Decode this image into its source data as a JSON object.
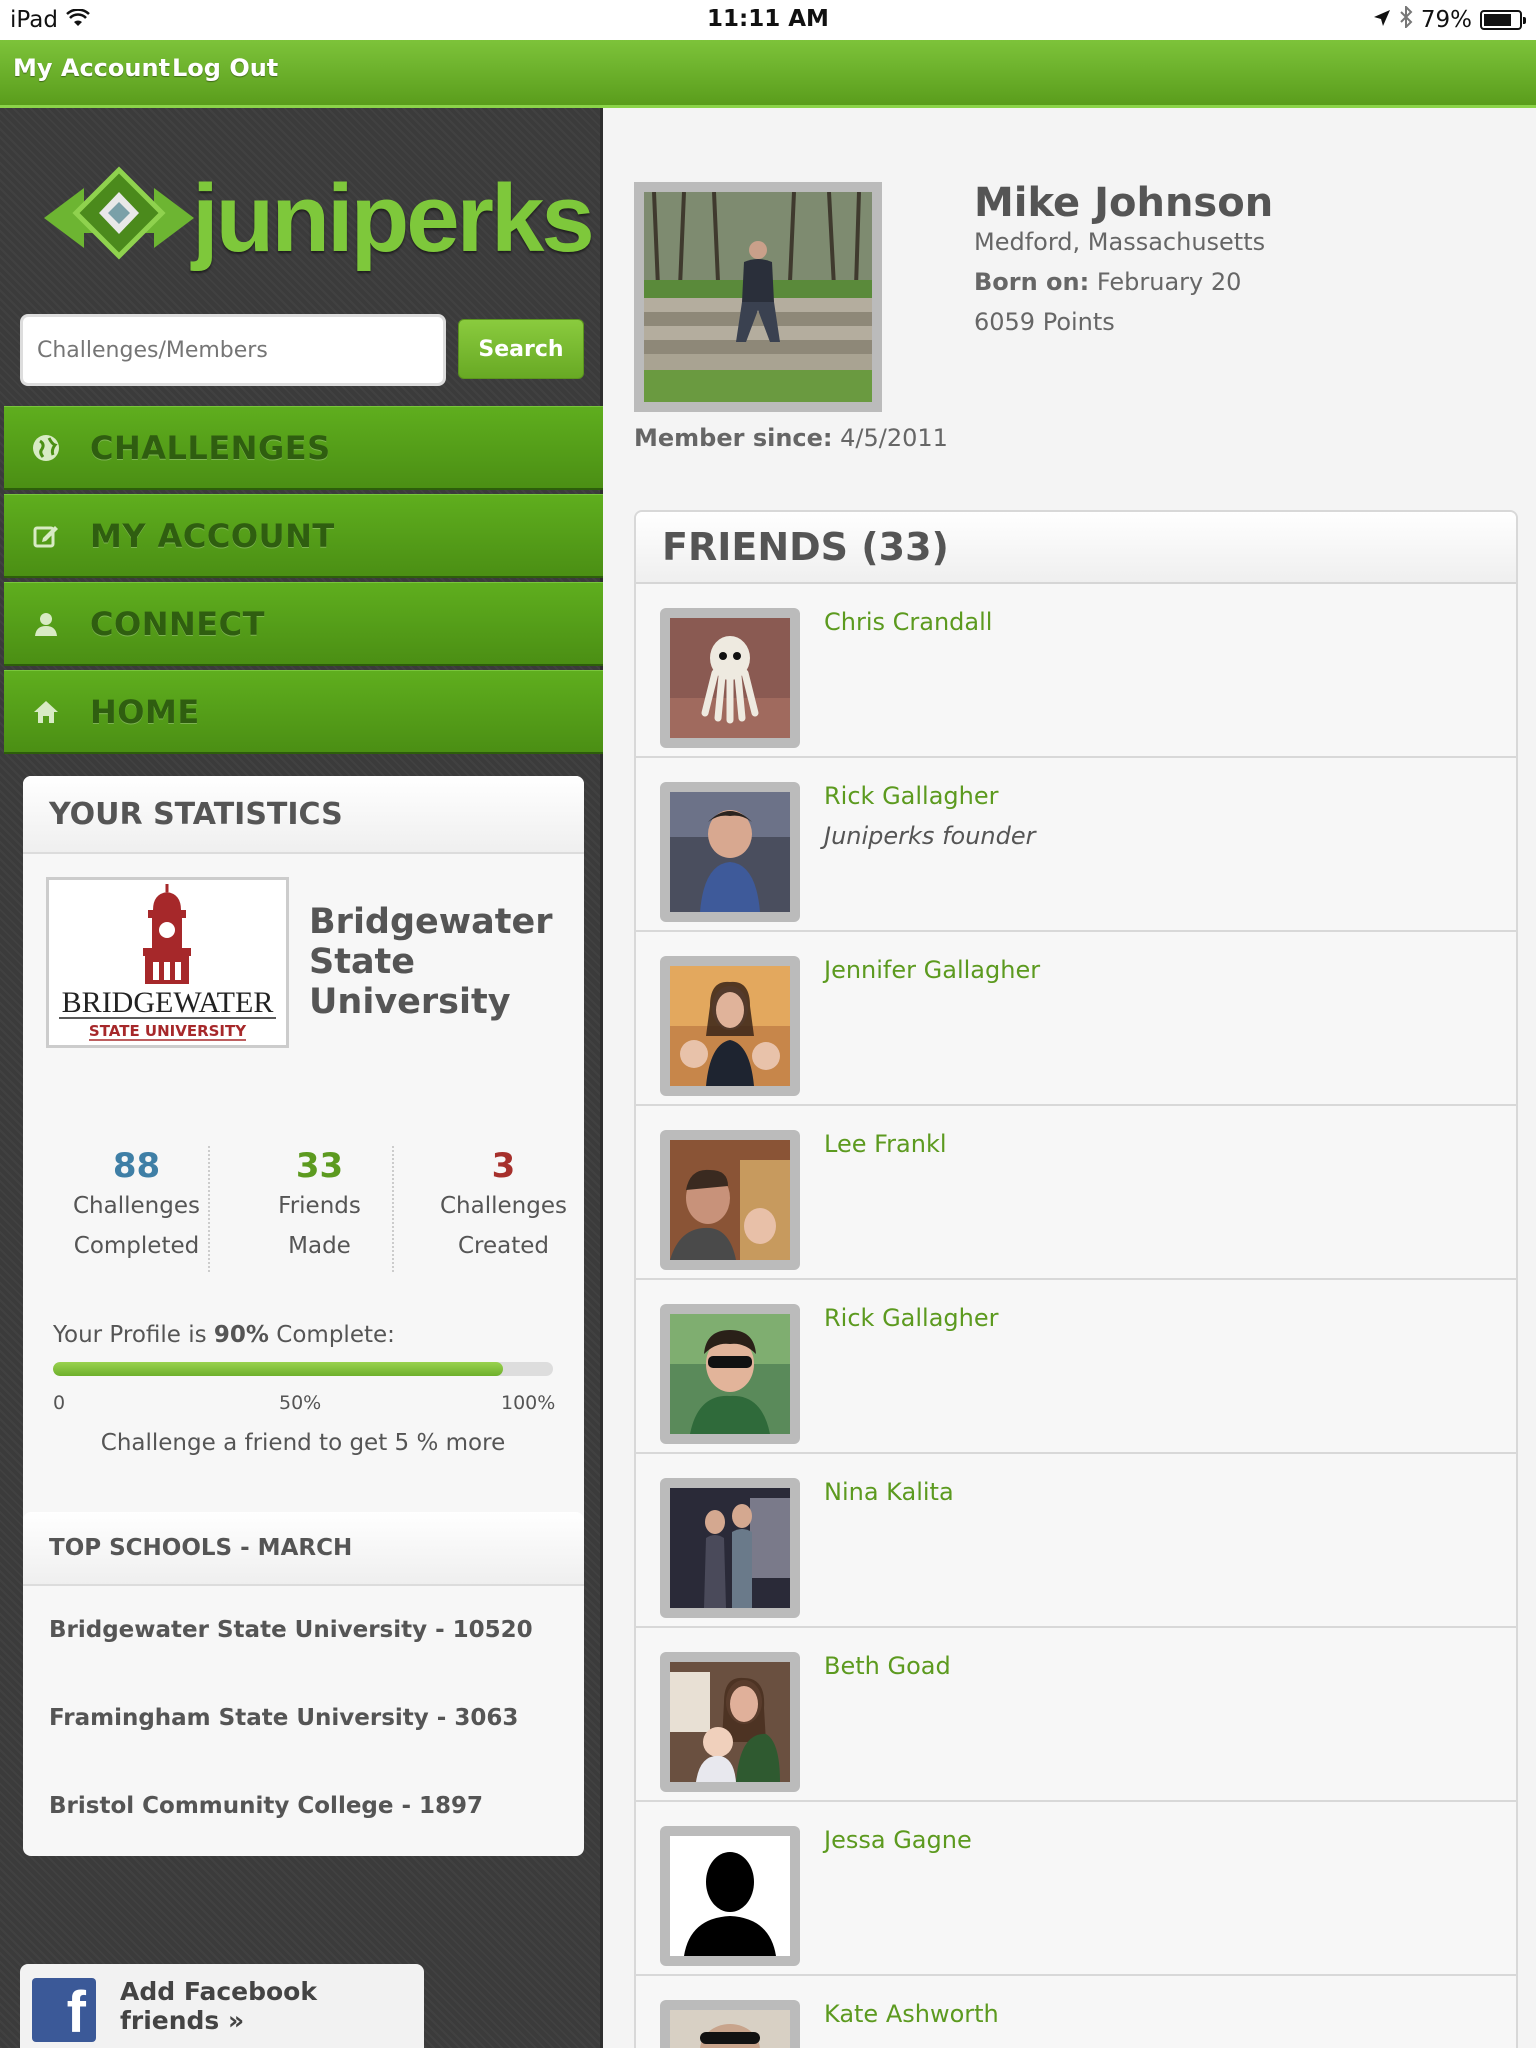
{
  "status_bar": {
    "device": "iPad",
    "time": "11:11 AM",
    "battery": "79%",
    "battery_level": 0.79
  },
  "topbar": {
    "my_account": "My Account",
    "log_out": "Log Out"
  },
  "sidebar": {
    "logo_text": "juniperks",
    "search": {
      "placeholder": "Challenges/Members",
      "button": "Search"
    },
    "nav": [
      {
        "label": "CHALLENGES",
        "icon": "globe-icon"
      },
      {
        "label": "MY ACCOUNT",
        "icon": "edit-icon"
      },
      {
        "label": "CONNECT",
        "icon": "user-icon"
      },
      {
        "label": "HOME",
        "icon": "home-icon"
      }
    ],
    "statistics": {
      "title": "YOUR STATISTICS",
      "school": {
        "logo_main": "BRIDGEWATER",
        "logo_sub": "STATE UNIVERSITY",
        "name": "Bridgewater State University"
      },
      "stats": [
        {
          "value": "88",
          "label1": "Challenges",
          "label2": "Completed",
          "color": "#3f7fa6"
        },
        {
          "value": "33",
          "label1": "Friends",
          "label2": "Made",
          "color": "#5c9a1f"
        },
        {
          "value": "3",
          "label1": "Challenges",
          "label2": "Created",
          "color": "#a6302c"
        }
      ],
      "profile": {
        "prefix": "Your Profile is ",
        "percent": "90%",
        "suffix": " Complete:",
        "value": 0.9,
        "ticks": [
          "0",
          "50%",
          "100%"
        ],
        "hint": "Challenge a friend to get 5 % more"
      }
    },
    "top_schools": {
      "title": "TOP SCHOOLS - MARCH",
      "items": [
        "Bridgewater State University - 10520",
        "Framingham State University - 3063",
        "Bristol Community College - 1897"
      ]
    },
    "facebook": {
      "icon_letter": "f",
      "label": "Add Facebook friends »"
    }
  },
  "profile": {
    "name": "Mike Johnson",
    "location": "Medford, Massachusetts",
    "born_label": "Born on:",
    "born_value": "February 20",
    "points": "6059 Points",
    "member_label": "Member since:",
    "member_value": "4/5/2011"
  },
  "friends": {
    "title": "FRIENDS (33)",
    "items": [
      {
        "name": "Chris Crandall",
        "subtitle": ""
      },
      {
        "name": "Rick Gallagher",
        "subtitle": "Juniperks founder"
      },
      {
        "name": "Jennifer Gallagher",
        "subtitle": ""
      },
      {
        "name": "Lee Frankl",
        "subtitle": ""
      },
      {
        "name": "Rick Gallagher",
        "subtitle": ""
      },
      {
        "name": "Nina Kalita",
        "subtitle": ""
      },
      {
        "name": "Beth Goad",
        "subtitle": ""
      },
      {
        "name": "Jessa Gagne",
        "subtitle": ""
      },
      {
        "name": "Kate Ashworth",
        "subtitle": ""
      }
    ]
  }
}
